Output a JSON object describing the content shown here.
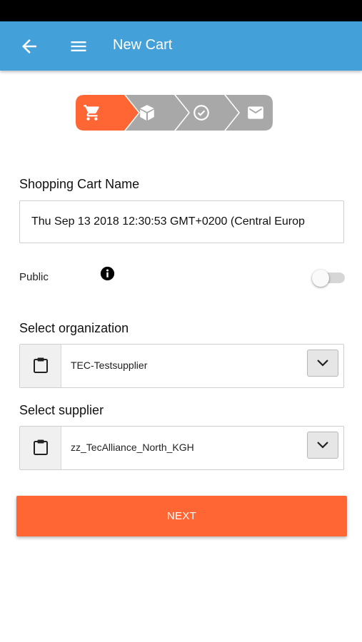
{
  "header": {
    "title": "New Cart",
    "back_icon": "arrow-left-icon",
    "menu_icon": "hamburger-menu-icon",
    "color": "#44a0d8"
  },
  "stepper": {
    "steps": [
      {
        "icon": "cart-icon",
        "active": true
      },
      {
        "icon": "box-icon",
        "active": false
      },
      {
        "icon": "check-circle-icon",
        "active": false
      },
      {
        "icon": "envelope-icon",
        "active": false
      }
    ],
    "active_color": "#ff6633",
    "inactive_color": "#a8a8a8"
  },
  "cart_name": {
    "label": "Shopping Cart Name",
    "value": "Thu Sep 13 2018 12:30:53 GMT+0200 (Central Europ"
  },
  "public": {
    "label": "Public",
    "info_icon": "info-icon",
    "enabled": false
  },
  "organization": {
    "label": "Select organization",
    "value": "TEC-Testsupplier",
    "icon": "clipboard-icon"
  },
  "supplier": {
    "label": "Select supplier",
    "value": "zz_TecAlliance_North_KGH",
    "icon": "clipboard-icon"
  },
  "next_button": {
    "label": "NEXT",
    "color": "#ff6633"
  }
}
